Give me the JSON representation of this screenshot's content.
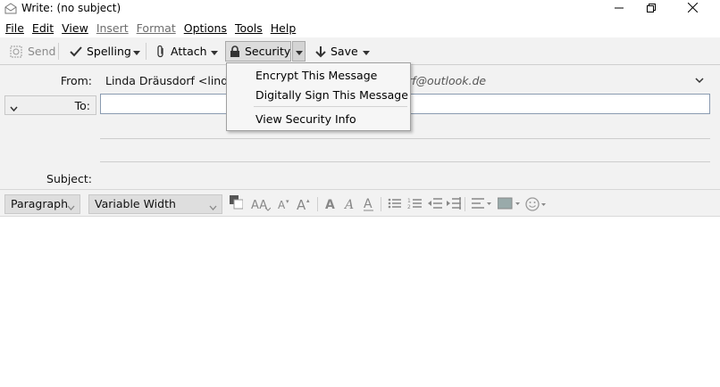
{
  "window": {
    "title": "Write: (no subject)"
  },
  "menubar": {
    "items": [
      {
        "label": "File",
        "enabled": true
      },
      {
        "label": "Edit",
        "enabled": true
      },
      {
        "label": "View",
        "enabled": true
      },
      {
        "label": "Insert",
        "enabled": false
      },
      {
        "label": "Format",
        "enabled": false
      },
      {
        "label": "Options",
        "enabled": true
      },
      {
        "label": "Tools",
        "enabled": true
      },
      {
        "label": "Help",
        "enabled": true
      }
    ]
  },
  "toolbar": {
    "send_label": "Send",
    "spelling_label": "Spelling",
    "attach_label": "Attach",
    "security_label": "Security",
    "save_label": "Save"
  },
  "header": {
    "from_label": "From:",
    "from_value": "Linda Dräusdorf <linda.dr",
    "from_value_tail": "rf@outlook.de",
    "to_label": "To:",
    "subject_label": "Subject:"
  },
  "formatbar": {
    "paragraph_value": "Paragraph",
    "font_value": "Variable Width"
  },
  "security_menu": {
    "items": [
      {
        "label": "Encrypt This Message"
      },
      {
        "label": "Digitally Sign This Message"
      },
      {
        "label": "View Security Info"
      }
    ]
  },
  "colors": {
    "toolbar_bg": "#f2f2f2",
    "border": "#cfcfcf",
    "input_border": "#8a9bb0"
  }
}
